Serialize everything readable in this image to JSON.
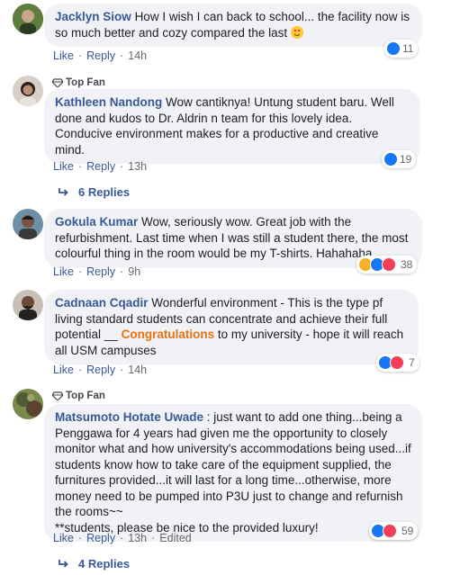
{
  "comments": [
    {
      "name": "Jacklyn Siow",
      "text": "How I wish I can back to school... the facility now is so much better and cozy compared the last",
      "like_label": "Like",
      "reply_label": "Reply",
      "time": "14h",
      "reaction_count": "11",
      "avatar_color": "#3f5a2f"
    },
    {
      "badge": "Top Fan",
      "name": "Kathleen Nandong",
      "text": "Wow cantiknya! Untung student baru. Well done and kudos to Dr. Aldrin n team for this lovely idea. Conducive environment makes for a productive and creative mind.",
      "like_label": "Like",
      "reply_label": "Reply",
      "time": "13h",
      "reaction_count": "19",
      "replies_label": "6 Replies",
      "avatar_color": "#8a6a55"
    },
    {
      "name": "Gokula Kumar",
      "text": "Wow, seriously wow. Great job with the refurbishment. Last time when I was still a student there, the most colourful thing in the room would be my T-shirts. Hahahaha",
      "like_label": "Like",
      "reply_label": "Reply",
      "time": "9h",
      "reaction_count": "38",
      "avatar_color": "#5a5048"
    },
    {
      "name": "Cadnaan Cqadir",
      "text_before": "Wonderful environment - This is the type pf living standard students can concentrate and achieve their full potential __",
      "highlight": "Congratulations",
      "text_after": "to my university - hope it will reach all USM campuses",
      "like_label": "Like",
      "reply_label": "Reply",
      "time": "14h",
      "reaction_count": "7",
      "avatar_color": "#6b4a3a"
    },
    {
      "badge": "Top Fan",
      "name": "Matsumoto Hotate Uwade",
      "text": ": just want to add one thing...being a Penggawa for 4 years had given me the opportunity to closely monitor what and how university's accommodations being used...if students know how to take care of the equipment supplied, the furnitures provided...it will last for a long time...otherwise, more money need to be pumped into P3U just to change and refurnish the rooms~~",
      "text2": "**students, please be nice to the provided luxury!",
      "like_label": "Like",
      "reply_label": "Reply",
      "time": "13h",
      "edited_label": "Edited",
      "reaction_count": "59",
      "replies_label": "4 Replies",
      "avatar_color": "#4e5b34"
    }
  ],
  "colors": {
    "link": "#385898",
    "bubble": "#f0f2f5",
    "highlight": "#e9710f",
    "like": "#1877f2",
    "love": "#f33e58"
  }
}
